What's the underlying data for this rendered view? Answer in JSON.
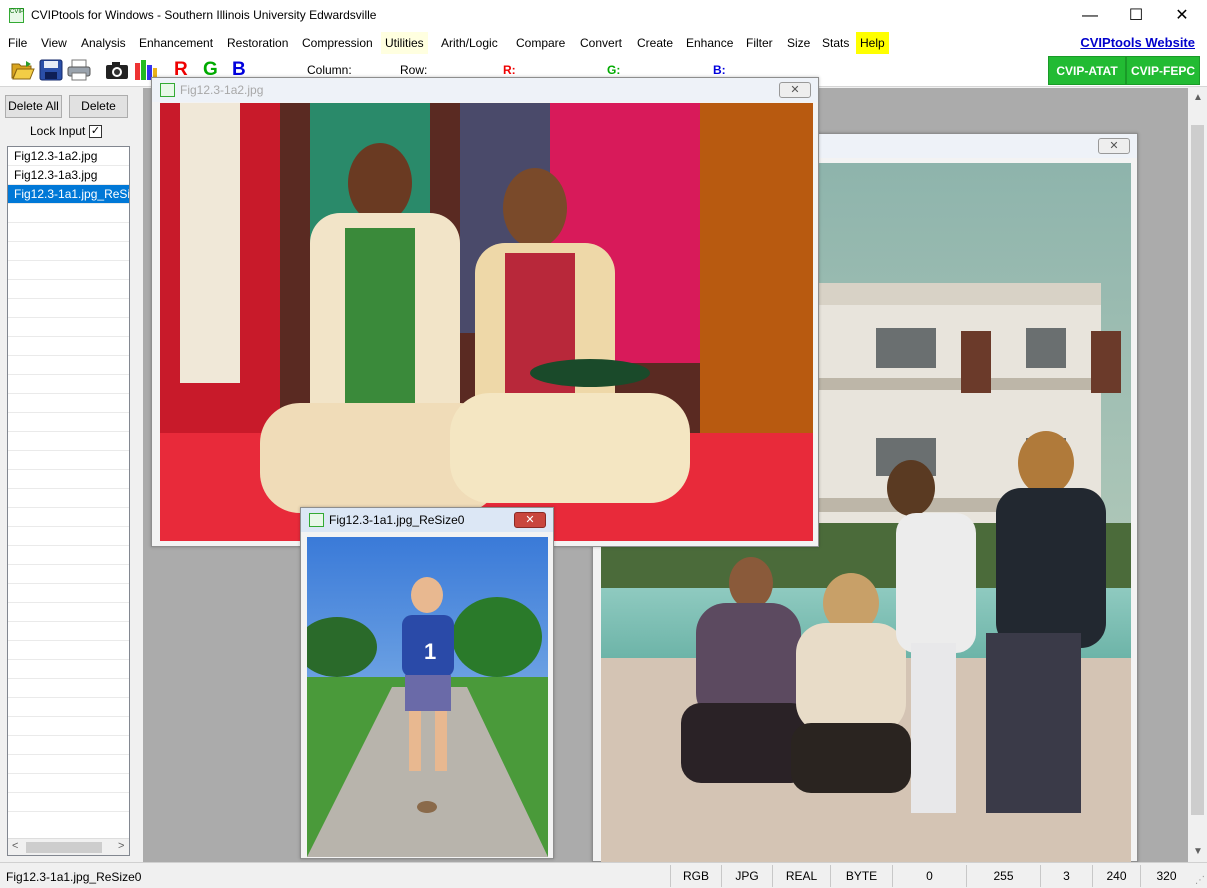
{
  "window": {
    "title": "CVIPtools for Windows - Southern Illinois University Edwardsville",
    "app_icon_text": "CVIP",
    "minimize": "—",
    "maximize": "☐",
    "close": "✕"
  },
  "menu": {
    "items": [
      "File",
      "View",
      "Analysis",
      "Enhancement",
      "Restoration",
      "Compression",
      "Utilities",
      "Arith/Logic",
      "Compare",
      "Convert",
      "Create",
      "Enhance",
      "Filter",
      "Size",
      "Stats",
      "Help"
    ],
    "website_link": "CVIPtools Website"
  },
  "toolbar": {
    "r": "R",
    "g": "G",
    "b": "B",
    "column_label": "Column:",
    "row_label": "Row:",
    "r_label": "R:",
    "g_label": "G:",
    "b_label": "B:",
    "atat": "CVIP-ATAT",
    "fepc": "CVIP-FEPC",
    "colors": {
      "red": "#ee0000",
      "green": "#00aa00",
      "blue": "#0000dd",
      "green_button": "#22bb33",
      "link": "#0000cc"
    }
  },
  "left_panel": {
    "delete_all": "Delete All",
    "delete": "Delete",
    "lock_input": "Lock Input",
    "lock_checked": "✓",
    "files": [
      "Fig12.3-1a2.jpg",
      "Fig12.3-1a3.jpg",
      "Fig12.3-1a1.jpg_ReSize0"
    ],
    "selected_index": 2,
    "scroll_left": "<",
    "scroll_right": ">"
  },
  "windows": {
    "wedding": {
      "title": "Fig12.3-1a2.jpg",
      "close": "✕"
    },
    "group": {
      "title": "",
      "close": "✕"
    },
    "boy": {
      "title": "Fig12.3-1a1.jpg_ReSize0",
      "close": "✕"
    }
  },
  "status": {
    "text": "Fig12.3-1a1.jpg_ReSize0",
    "cells": [
      "RGB",
      "JPG",
      "REAL",
      "BYTE",
      "0",
      "255",
      "3",
      "240",
      "320"
    ]
  }
}
